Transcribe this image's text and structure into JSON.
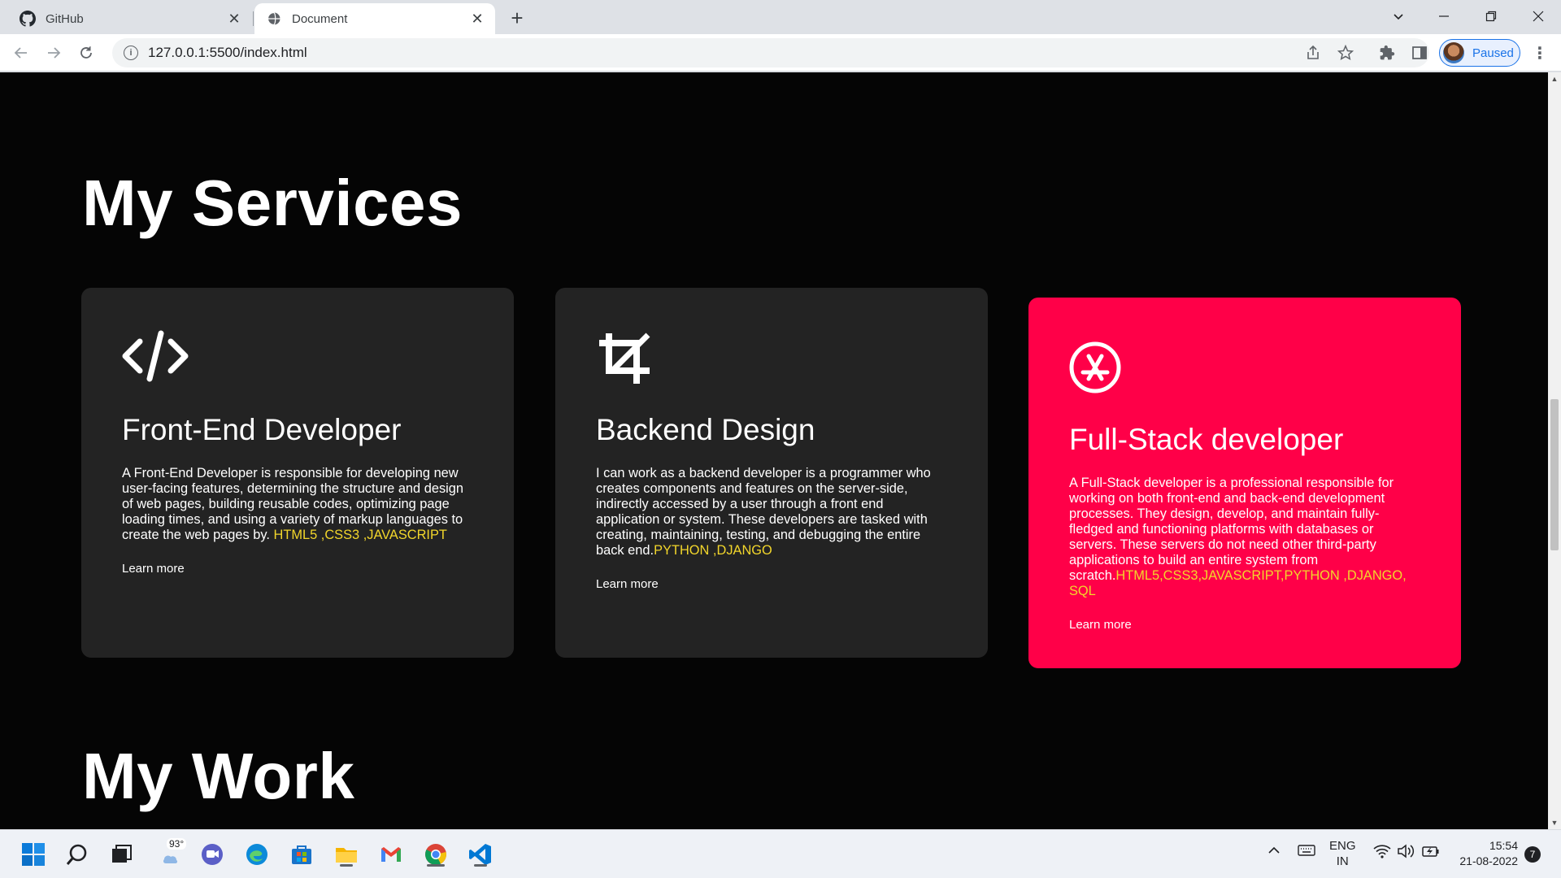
{
  "browser": {
    "tabs": [
      {
        "title": "GitHub",
        "icon": "github-icon",
        "active": false
      },
      {
        "title": "Document",
        "icon": "globe-icon",
        "active": true
      }
    ],
    "address": "127.0.0.1:5500/index.html",
    "profile_status": "Paused"
  },
  "page": {
    "services_title": "My Services",
    "work_title": "My Work",
    "cards": [
      {
        "icon": "code-icon",
        "title": "Front-End Developer",
        "desc": "A Front-End Developer is responsible for developing new user-facing features, determining the structure and design of web pages, building reusable codes, optimizing page loading times, and using a variety of markup languages to create the web pages by.",
        "tech": " HTML5 ,CSS3 ,JAVASCRIPT",
        "link": "Learn more"
      },
      {
        "icon": "crop-icon",
        "title": "Backend Design",
        "desc": "I can work as a backend developer is a programmer who creates components and features on the server-side, indirectly accessed by a user through a front end application or system. These developers are tasked with creating, maintaining, testing, and debugging the entire back end.",
        "tech": "PYTHON ,DJANGO",
        "link": "Learn more"
      },
      {
        "icon": "app-store-icon",
        "title": "Full-Stack developer",
        "desc": "A Full-Stack developer is a professional responsible for working on both front-end and back-end development processes. They design, develop, and maintain fully-fledged and functioning platforms with databases or servers. These servers do not need other third-party applications to build an entire system from scratch.",
        "tech": "HTML5,CSS3,JAVASCRIPT,PYTHON ,DJANGO, SQL",
        "link": "Learn more"
      }
    ],
    "colors": {
      "background": "#050505",
      "card": "#232323",
      "highlight_card": "#ff0048",
      "tech_text": "#f2d62b"
    }
  },
  "taskbar": {
    "weather": "93°",
    "lang_line1": "ENG",
    "lang_line2": "IN",
    "time": "15:54",
    "date": "21-08-2022",
    "notifications": "7",
    "apps": [
      "start-icon",
      "search-icon",
      "task-view-icon",
      "weather-icon",
      "teams-chat-icon",
      "edge-icon",
      "store-icon",
      "file-explorer-icon",
      "gmail-icon",
      "chrome-icon",
      "vscode-icon"
    ]
  }
}
